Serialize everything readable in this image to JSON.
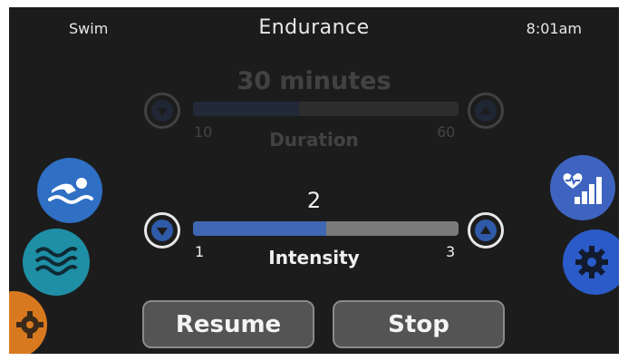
{
  "header": {
    "mode": "Swim",
    "title": "Endurance",
    "time": "8:01am"
  },
  "duration": {
    "value_text": "30 minutes",
    "label": "Duration",
    "min": "10",
    "max": "60",
    "level": 0.4
  },
  "intensity": {
    "value_text": "2",
    "label": "Intensity",
    "min": "1",
    "max": "3",
    "level": 0.5
  },
  "actions": {
    "resume": "Resume",
    "stop": "Stop"
  },
  "icons": {
    "left": [
      "swimmer-icon",
      "waves-icon",
      "gear-icon"
    ],
    "right": [
      "heart-stats-icon",
      "gear-icon"
    ]
  },
  "colors": {
    "background": "#1c1c1c",
    "accent_blue": "#3f67b3",
    "swim_blue": "#2f6fc4",
    "waves_teal": "#1f8fa6",
    "orange": "#d9791f",
    "settings_blue": "#2a5bc8"
  }
}
